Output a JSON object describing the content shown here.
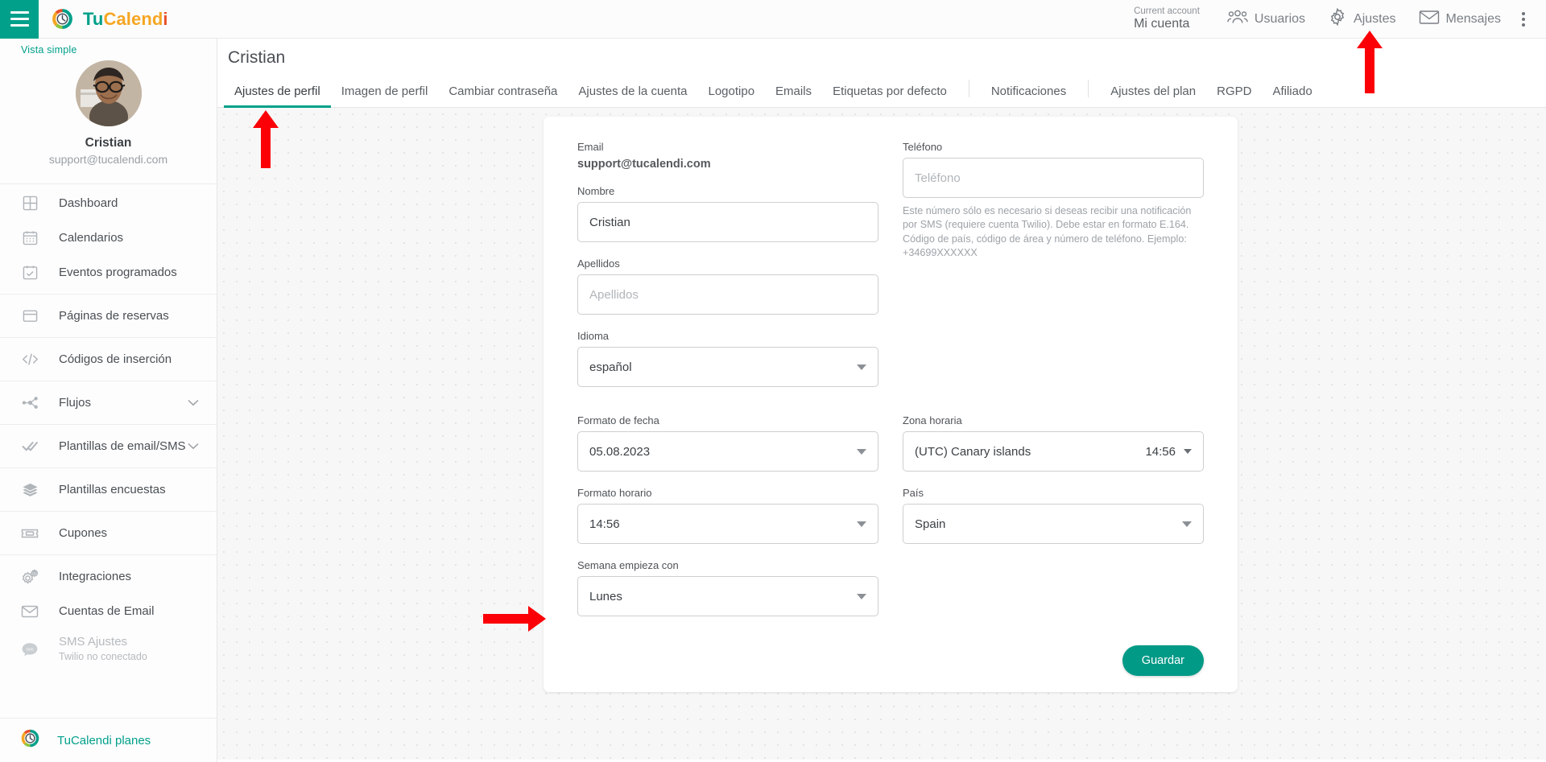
{
  "topbar": {
    "menu_icon": "hamburger-menu-icon",
    "brand": {
      "part1": "Tu",
      "part2": "Calend",
      "part3": "i"
    },
    "account": {
      "label": "Current account",
      "value": "Mi cuenta"
    },
    "items": [
      {
        "label": "Usuarios",
        "icon": "users-icon"
      },
      {
        "label": "Ajustes",
        "icon": "gear-icon"
      },
      {
        "label": "Mensajes",
        "icon": "envelope-icon"
      }
    ],
    "overflow_icon": "kebab-menu-icon"
  },
  "sidebar": {
    "view_mode": "Vista simple",
    "profile": {
      "name": "Cristian",
      "email": "support@tucalendi.com",
      "avatar": "user-avatar"
    },
    "items": [
      {
        "label": "Dashboard",
        "icon": "dashboard-grid-icon",
        "sub": "",
        "caret": false,
        "dim": false,
        "sep_after": false
      },
      {
        "label": "Calendarios",
        "icon": "calendar-icon",
        "sub": "",
        "caret": false,
        "dim": false,
        "sep_after": false
      },
      {
        "label": "Eventos programados",
        "icon": "calendar-check-icon",
        "sub": "",
        "caret": false,
        "dim": false,
        "sep_after": true
      },
      {
        "label": "Páginas de reservas",
        "icon": "window-icon",
        "sub": "",
        "caret": false,
        "dim": false,
        "sep_after": true
      },
      {
        "label": "Códigos de inserción",
        "icon": "code-icon",
        "sub": "",
        "caret": false,
        "dim": false,
        "sep_after": true
      },
      {
        "label": "Flujos",
        "icon": "flow-nodes-icon",
        "sub": "",
        "caret": true,
        "dim": false,
        "sep_after": true
      },
      {
        "label": "Plantillas de email/SMS",
        "icon": "double-check-icon",
        "sub": "",
        "caret": true,
        "dim": false,
        "sep_after": true
      },
      {
        "label": "Plantillas encuestas",
        "icon": "layers-icon",
        "sub": "",
        "caret": false,
        "dim": false,
        "sep_after": true
      },
      {
        "label": "Cupones",
        "icon": "ticket-icon",
        "sub": "",
        "caret": false,
        "dim": false,
        "sep_after": true
      },
      {
        "label": "Integraciones",
        "icon": "gears-icon",
        "sub": "",
        "caret": false,
        "dim": false,
        "sep_after": false
      },
      {
        "label": "Cuentas de Email",
        "icon": "envelope-outline-icon",
        "sub": "",
        "caret": false,
        "dim": false,
        "sep_after": false
      },
      {
        "label": "SMS Ajustes",
        "icon": "sms-bubble-icon",
        "sub": "Twilio no conectado",
        "caret": false,
        "dim": true,
        "sep_after": false
      }
    ],
    "plans": {
      "label": "TuCalendi planes",
      "icon": "tucalendi-logo-icon"
    }
  },
  "main": {
    "page_title": "Cristian",
    "tabs": [
      {
        "label": "Ajustes de perfil",
        "active": true,
        "divider_after": false
      },
      {
        "label": "Imagen de perfil",
        "active": false,
        "divider_after": false
      },
      {
        "label": "Cambiar contraseña",
        "active": false,
        "divider_after": false
      },
      {
        "label": "Ajustes de la cuenta",
        "active": false,
        "divider_after": false
      },
      {
        "label": "Logotipo",
        "active": false,
        "divider_after": false
      },
      {
        "label": "Emails",
        "active": false,
        "divider_after": false
      },
      {
        "label": "Etiquetas por defecto",
        "active": false,
        "divider_after": true
      },
      {
        "label": "Notificaciones",
        "active": false,
        "divider_after": true
      },
      {
        "label": "Ajustes del plan",
        "active": false,
        "divider_after": false
      },
      {
        "label": "RGPD",
        "active": false,
        "divider_after": false
      },
      {
        "label": "Afiliado",
        "active": false,
        "divider_after": false
      }
    ],
    "form": {
      "email_label": "Email",
      "email_value": "support@tucalendi.com",
      "nombre_label": "Nombre",
      "nombre_value": "Cristian",
      "apellidos_label": "Apellidos",
      "apellidos_placeholder": "Apellidos",
      "idioma_label": "Idioma",
      "idioma_value": "español",
      "telefono_label": "Teléfono",
      "telefono_placeholder": "Teléfono",
      "telefono_hint": "Este número sólo es necesario si deseas recibir una notificación por SMS (requiere cuenta Twilio). Debe estar en formato E.164. Código de país, código de área y número de teléfono. Ejemplo: +34699XXXXXX",
      "fecha_label": "Formato de fecha",
      "fecha_value": "05.08.2023",
      "zona_label": "Zona horaria",
      "zona_value": "(UTC) Canary islands",
      "zona_time": "14:56",
      "horario_label": "Formato horario",
      "horario_value": "14:56",
      "pais_label": "País",
      "pais_value": "Spain",
      "semana_label": "Semana empieza con",
      "semana_value": "Lunes",
      "save_label": "Guardar"
    }
  },
  "colors": {
    "brand_teal": "#00a08a",
    "brand_orange": "#f5a623",
    "brand_red": "#e8522a",
    "save_button": "#009a87",
    "annotation_red": "#fb0007"
  }
}
